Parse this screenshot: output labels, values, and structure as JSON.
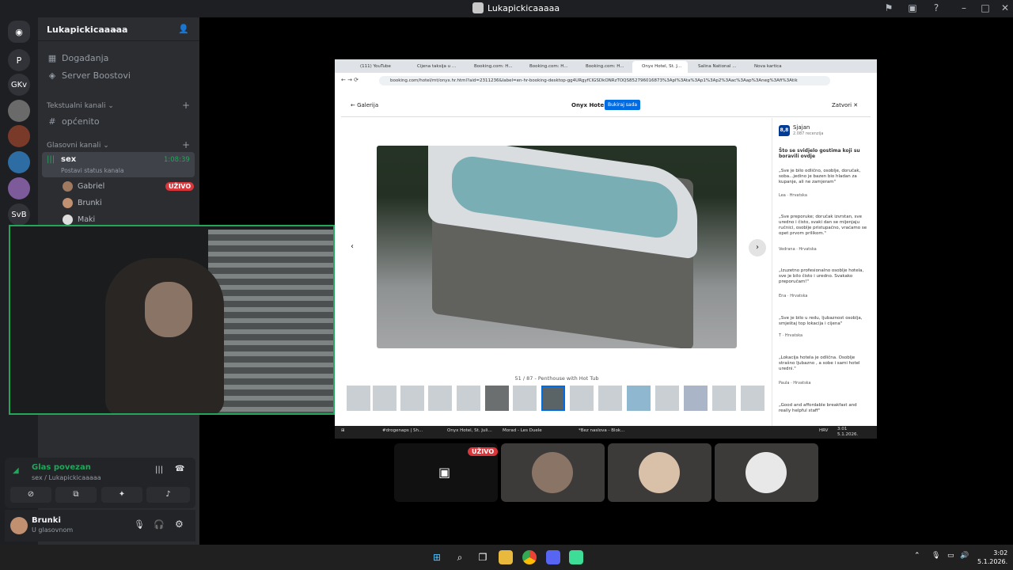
{
  "window": {
    "title": "Lukapickicaaaaa"
  },
  "server": {
    "name": "Lukapickicaaaaa",
    "rail_items": [
      "P",
      "GKv",
      "SvB"
    ],
    "events_label": "Događanja",
    "boost_label": "Server Boostovi",
    "text_category": "Tekstualni kanali",
    "text_channel": "općenito",
    "voice_category": "Glasovni kanali",
    "voice_channel": {
      "name": "sex",
      "timer": "1:08:39",
      "status": "Postavi status kanala"
    },
    "voice_users": [
      {
        "name": "Gabriel",
        "badge": "UŽIVO"
      },
      {
        "name": "Brunki"
      },
      {
        "name": "Maki"
      }
    ]
  },
  "voice_panel": {
    "status": "Glas povezan",
    "channel": "sex / Lukapickicaaaaa"
  },
  "user_panel": {
    "name": "Brunki",
    "status": "U glasovnom"
  },
  "stream": {
    "browser_tabs": [
      "(111) YouTube",
      "Cijena taksija u ...",
      "Booking.com: H...",
      "Booking.com: H...",
      "Booking.com: H...",
      "Onyx Hotel, St. J...",
      "Salina National ...",
      "Nova kartica"
    ],
    "url": "booking.com/hotel/mt/onyx.hr.html?aid=2311236&label=en-hr-booking-desktop-gg4URgyfCIGSDkONRzTOQS852796016873%3Apl%3Ata%3Ap1%3Ap2%3Aac%3Aap%3Aneg%3Afi%3Atik",
    "gallery_back": "Galerija",
    "hotel_name": "Onyx Hotel",
    "book_button": "Bukiraj sada",
    "close_label": "Zatvori",
    "photo_caption": "51 / 87 - Penthouse with Hot Tub",
    "score": "8,8",
    "score_label": "Sjajan",
    "score_count": "2.087 recenzija",
    "reviews_title": "Što se svidjelo gostima koji su boravili ovdje",
    "reviews": [
      {
        "text": "„Sve je bilo odlično, osoblje, doručak, soba...jedino je bazen bio hladan za kupanje, ali ne zamjeram\"",
        "author": "Lea",
        "country": "Hrvatska"
      },
      {
        "text": "„Sve preporuke; doručak izvrstan, sve uredno i čisto, svaki dan se mijenjaju ručnici, osoblje pristupačno, vraćamo se opet prvom prilikom.\"",
        "author": "Vedrana",
        "country": "Hrvatska"
      },
      {
        "text": "„Izuzetno profesionalno osoblje hotela, sve je bilo čisto i uredno. Svakako preporučam!\"",
        "author": "Ena",
        "country": "Hrvatska"
      },
      {
        "text": "„Sve je bilo u redu, ljubaznost osoblja, smještaj top lokacija i cijena\"",
        "author": "T",
        "country": "Hrvatska"
      },
      {
        "text": "„Lokacija hotela je odlična. Osoblje strašno ljubazno , a sobe i sami hotel uredni.\"",
        "author": "Paula",
        "country": "Hrvatska"
      },
      {
        "text": "„Good and affordable breakfast and really helpful staff\"",
        "author": "",
        "country": ""
      }
    ],
    "win_taskbar": [
      "#drogenaps | Sh...",
      "Onyx Hotel, St. Juli...",
      "Morad - Les Duele",
      "*Bez naslova - Blok..."
    ],
    "win_time": "3:01",
    "win_date": "5.1.2026.",
    "win_lang": "HRV"
  },
  "tiles": {
    "live_badge": "UŽIVO"
  },
  "taskbar": {
    "time": "3:02",
    "date": "5.1.2026."
  }
}
